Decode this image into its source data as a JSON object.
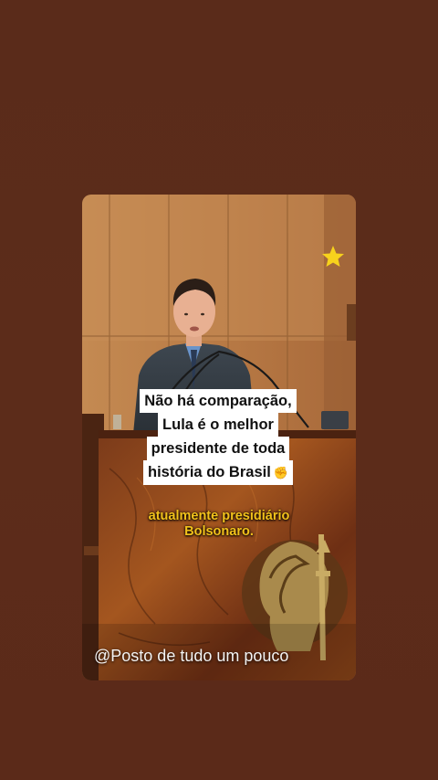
{
  "story": {
    "caption_lines": [
      "Não há comparação,",
      "Lula é o melhor",
      "presidente de toda",
      "história do Brasil"
    ],
    "caption_emoji": "✊",
    "subtitle_lines": [
      "atualmente presidiário",
      "Bolsonaro."
    ],
    "watermark": "@Posto de tudo um pouco"
  },
  "colors": {
    "background": "#5b2b1a",
    "subtitle": "#f2c21b",
    "star": "#f7d21c",
    "caption_bg": "#ffffff"
  },
  "icons": {
    "star": "star-icon",
    "emblem": "emblem-icon",
    "fist": "raised-fist-emoji"
  }
}
